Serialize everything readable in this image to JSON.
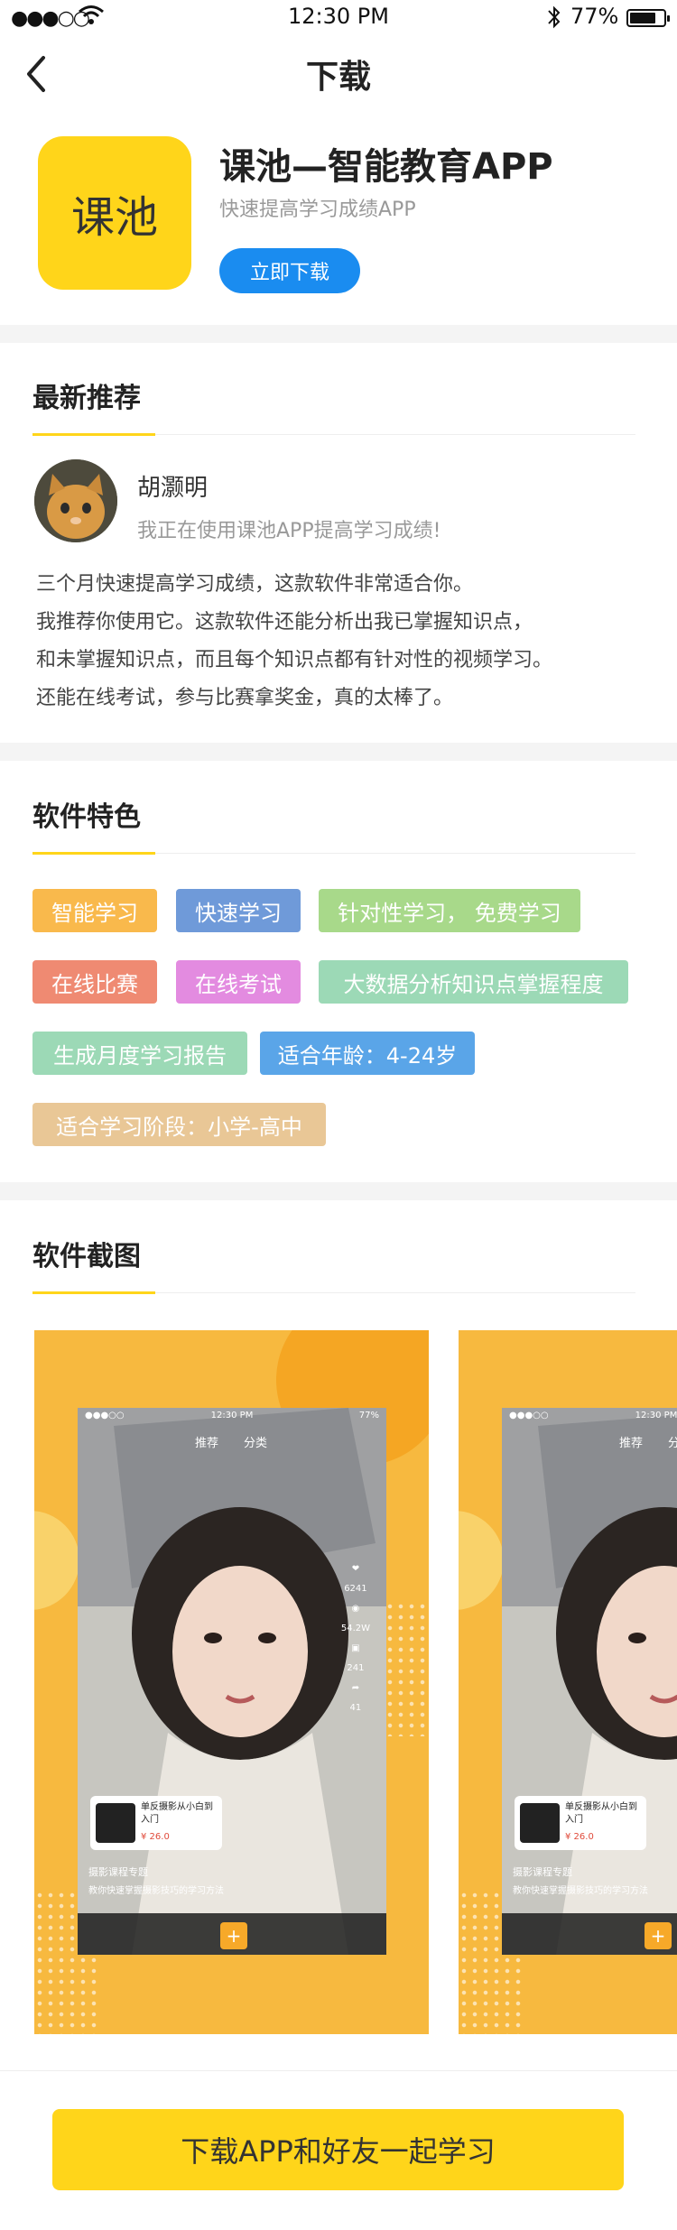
{
  "status_bar": {
    "time": "12:30 PM",
    "battery": "77%",
    "battery_level": 0.77,
    "icons": [
      "signal-icon",
      "wifi-icon",
      "bluetooth-icon",
      "battery-icon"
    ]
  },
  "nav": {
    "title": "下载",
    "back_icon": "chevron-left-icon"
  },
  "app": {
    "logo_text": "课池",
    "name": "课池—智能教育APP",
    "subtitle": "快速提高学习成绩APP",
    "download_label": "立即下载",
    "brand_color": "#ffd51a",
    "button_color": "#1a8cf0"
  },
  "recommend": {
    "title": "最新推荐",
    "reviewer": "胡灏明",
    "quote": "我正在使用课池APP提高学习成绩!",
    "body_lines": [
      "三个月快速提高学习成绩，这款软件非常适合你。",
      "我推荐你使用它。这款软件还能分析出我已掌握知识点，",
      "和未掌握知识点，而且每个知识点都有针对性的视频学习。",
      "还能在线考试，参与比赛拿奖金，真的太棒了。"
    ]
  },
  "features": {
    "title": "软件特色",
    "tags": [
      {
        "label": "智能学习",
        "color": "#f9b94c"
      },
      {
        "label": "快速学习",
        "color": "#6f9ad9"
      },
      {
        "label": "针对性学习， 免费学习",
        "color": "#a8d98a"
      },
      {
        "label": "在线比赛",
        "color": "#ef8a72"
      },
      {
        "label": "在线考试",
        "color": "#e38be0"
      },
      {
        "label": "大数据分析知识点掌握程度",
        "color": "#9cd9b6"
      },
      {
        "label": "生成月度学习报告",
        "color": "#9cd9b6"
      },
      {
        "label": "适合年龄：4-24岁",
        "color": "#5aa5e8"
      },
      {
        "label": "适合学习阶段：小学-高中",
        "color": "#e9c796"
      }
    ]
  },
  "screenshots": {
    "title": "软件截图",
    "phone_ui": {
      "time": "12:30 PM",
      "battery": "77%",
      "tab_recommend": "推荐",
      "tab_category": "分类",
      "likes": "6241",
      "fans": "54.2W",
      "gifts": "241",
      "shares": "41",
      "course_title": "单反摄影从小白到入门",
      "course_price": "¥ 26.0",
      "topic_title": "摄影课程专题",
      "topic_desc": "教你快速掌握摄影技巧的学习方法"
    }
  },
  "cta": {
    "label": "下载APP和好友一起学习"
  }
}
